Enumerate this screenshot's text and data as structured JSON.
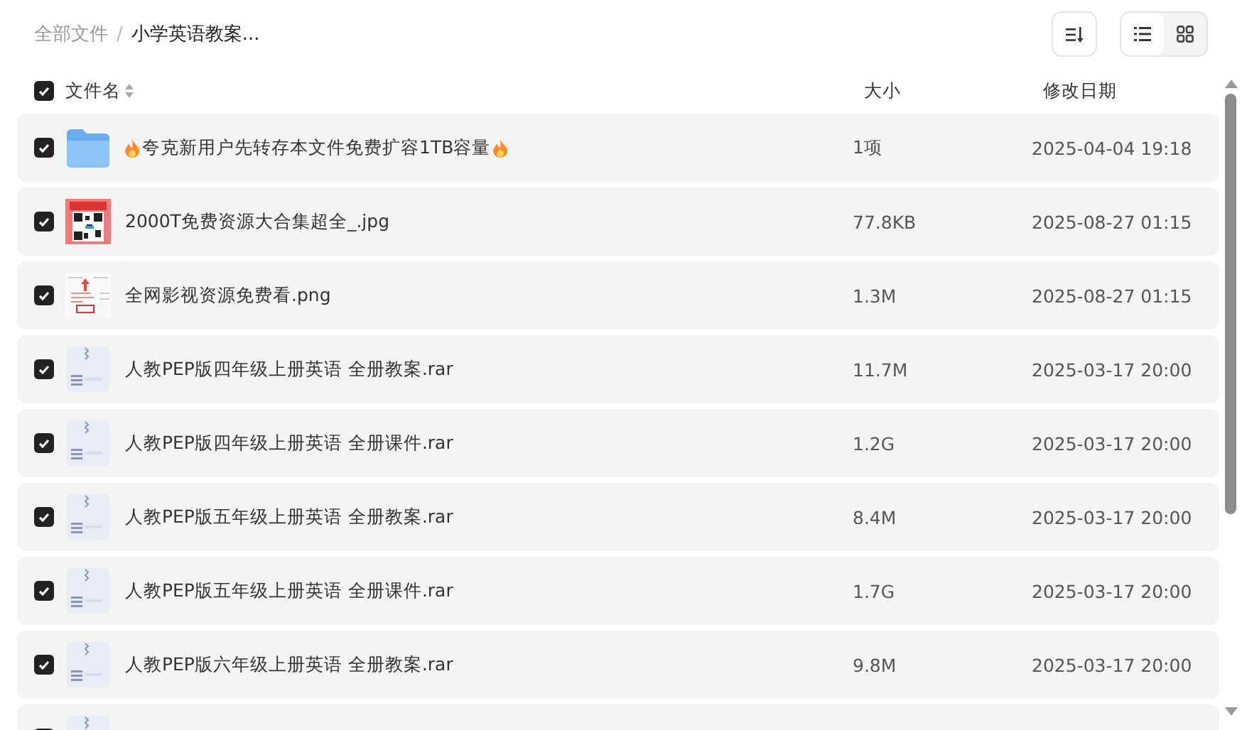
{
  "breadcrumb": {
    "separator": "/",
    "items": [
      {
        "label": "全部文件",
        "current": false
      },
      {
        "label": "小学英语教案...",
        "current": true
      }
    ]
  },
  "toolbar": {
    "view_modes": [
      {
        "kind": "list",
        "selected": true
      },
      {
        "kind": "grid",
        "selected": false
      }
    ]
  },
  "table": {
    "select_all": {
      "checked": true
    },
    "columns": [
      "文件名",
      "大小",
      "修改日期"
    ],
    "rows": [
      {
        "kind": "folder",
        "checked": true,
        "name": "夸克新用户先转存本文件免费扩容1TB容量",
        "flames": true,
        "size": "1项",
        "date": "2025-04-04 19:18"
      },
      {
        "kind": "qr-image",
        "checked": true,
        "name": "2000T免费资源大合集超全_.jpg",
        "size": "77.8KB",
        "date": "2025-08-27 01:15"
      },
      {
        "kind": "doc-image",
        "checked": true,
        "name": "全网影视资源免费看.png",
        "size": "1.3M",
        "date": "2025-08-27 01:15"
      },
      {
        "kind": "archive",
        "checked": true,
        "name": "人教PEP版四年级上册英语 全册教案.rar",
        "size": "11.7M",
        "date": "2025-03-17 20:00"
      },
      {
        "kind": "archive",
        "checked": true,
        "name": "人教PEP版四年级上册英语 全册课件.rar",
        "size": "1.2G",
        "date": "2025-03-17 20:00"
      },
      {
        "kind": "archive",
        "checked": true,
        "name": "人教PEP版五年级上册英语 全册教案.rar",
        "size": "8.4M",
        "date": "2025-03-17 20:00"
      },
      {
        "kind": "archive",
        "checked": true,
        "name": "人教PEP版五年级上册英语 全册课件.rar",
        "size": "1.7G",
        "date": "2025-03-17 20:00"
      },
      {
        "kind": "archive",
        "checked": true,
        "name": "人教PEP版六年级上册英语 全册教案.rar",
        "size": "9.8M",
        "date": "2025-03-17 20:00"
      },
      {
        "kind": "archive",
        "checked": true
      }
    ]
  }
}
